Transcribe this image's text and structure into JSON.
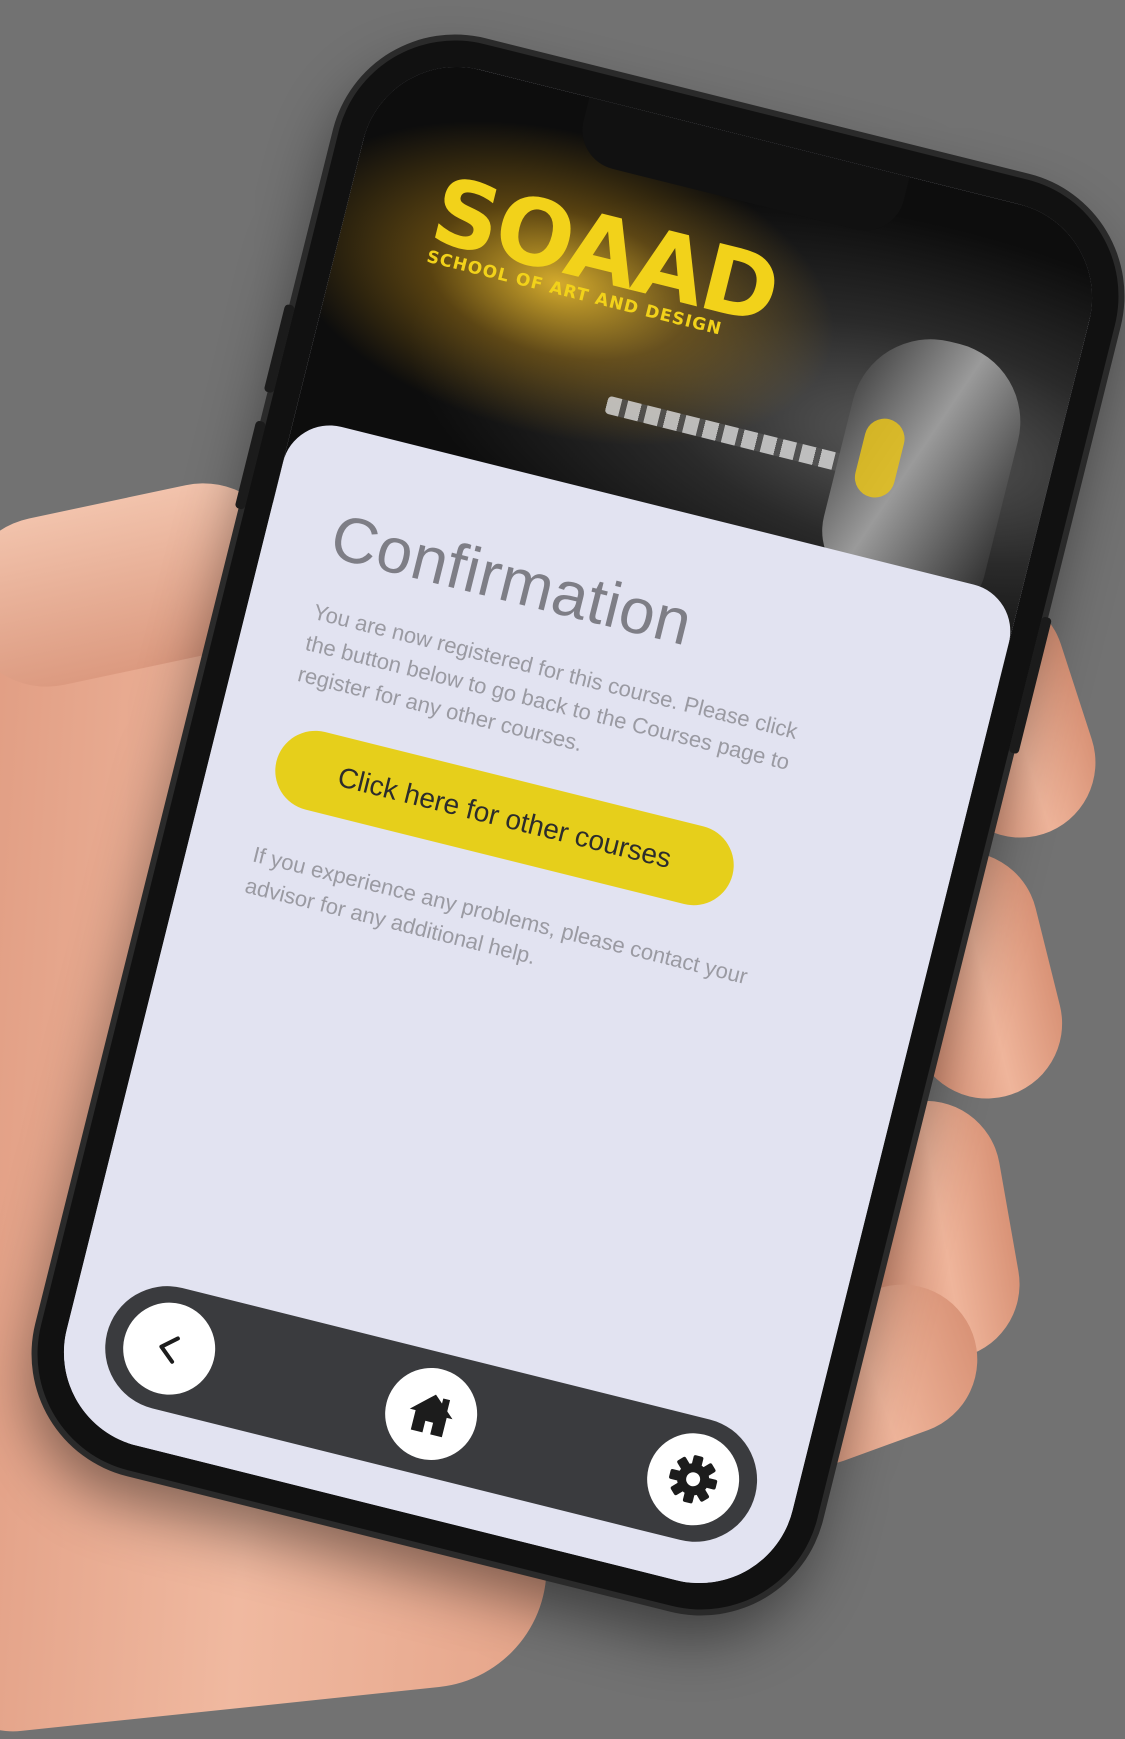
{
  "hero": {
    "logo_main": "SOAAD",
    "logo_sub": "SCHOOL OF ART AND DESIGN"
  },
  "content": {
    "title": "Confirmation",
    "paragraph_1": "You are now registered for this course. Please click the button below to go back to the Courses page to register for any other courses.",
    "button_label": "Click here for other courses",
    "paragraph_2": "If you experience any problems, please contact your advisor for any additional help."
  },
  "nav": {
    "items": [
      {
        "icon": "back-arrow-icon"
      },
      {
        "icon": "home-icon"
      },
      {
        "icon": "gear-icon"
      }
    ]
  },
  "colors": {
    "accent": "#e6cf1b",
    "card_background": "#e2e3f1",
    "navbar": "#3a3b3e",
    "backdrop": "#727272"
  }
}
